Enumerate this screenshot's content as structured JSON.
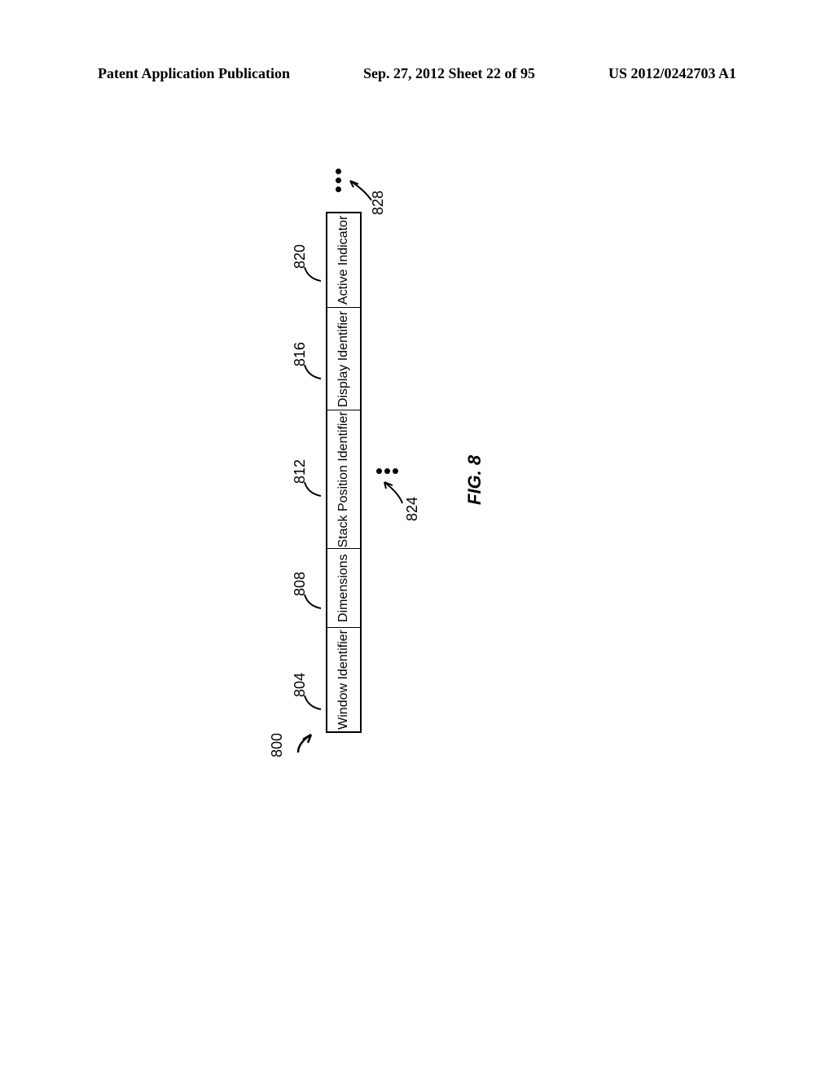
{
  "header": {
    "left": "Patent Application Publication",
    "center": "Sep. 27, 2012  Sheet 22 of 95",
    "right": "US 2012/0242703 A1"
  },
  "diagram": {
    "ref_main": "800",
    "cells": [
      {
        "label": "Window Identifier",
        "ref": "804"
      },
      {
        "label": "Dimensions",
        "ref": "808"
      },
      {
        "label": "Stack Position Identifier",
        "ref": "812"
      },
      {
        "label": "Display Identifier",
        "ref": "816"
      },
      {
        "label": "Active Indicator",
        "ref": "820"
      }
    ],
    "continuation_refs": {
      "below": "824",
      "right": "828"
    },
    "figure_label": "FIG. 8"
  }
}
